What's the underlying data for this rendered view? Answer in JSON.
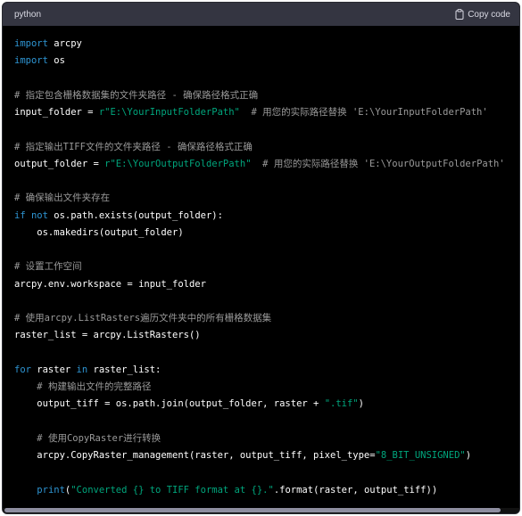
{
  "header": {
    "language": "python",
    "copy_label": "Copy code"
  },
  "code": {
    "lines": [
      [
        {
          "t": "kw",
          "v": "import"
        },
        {
          "t": "pl",
          "v": " arcpy"
        }
      ],
      [
        {
          "t": "kw",
          "v": "import"
        },
        {
          "t": "pl",
          "v": " os"
        }
      ],
      [],
      [
        {
          "t": "cmt",
          "v": "# 指定包含栅格数据集的文件夹路径 - 确保路径格式正确"
        }
      ],
      [
        {
          "t": "pl",
          "v": "input_folder = "
        },
        {
          "t": "str",
          "v": "r\"E:\\YourInputFolderPath\""
        },
        {
          "t": "cmt",
          "v": "  # 用您的实际路径替换 'E:\\YourInputFolderPath'"
        }
      ],
      [],
      [
        {
          "t": "cmt",
          "v": "# 指定输出TIFF文件的文件夹路径 - 确保路径格式正确"
        }
      ],
      [
        {
          "t": "pl",
          "v": "output_folder = "
        },
        {
          "t": "str",
          "v": "r\"E:\\YourOutputFolderPath\""
        },
        {
          "t": "cmt",
          "v": "  # 用您的实际路径替换 'E:\\YourOutputFolderPath'"
        }
      ],
      [],
      [
        {
          "t": "cmt",
          "v": "# 确保输出文件夹存在"
        }
      ],
      [
        {
          "t": "kw",
          "v": "if"
        },
        {
          "t": "pl",
          "v": " "
        },
        {
          "t": "kw",
          "v": "not"
        },
        {
          "t": "pl",
          "v": " os.path.exists(output_folder):"
        }
      ],
      [
        {
          "t": "pl",
          "v": "    os.makedirs(output_folder)"
        }
      ],
      [],
      [
        {
          "t": "cmt",
          "v": "# 设置工作空间"
        }
      ],
      [
        {
          "t": "pl",
          "v": "arcpy.env.workspace = input_folder"
        }
      ],
      [],
      [
        {
          "t": "cmt",
          "v": "# 使用arcpy.ListRasters遍历文件夹中的所有栅格数据集"
        }
      ],
      [
        {
          "t": "pl",
          "v": "raster_list = arcpy.ListRasters()"
        }
      ],
      [],
      [
        {
          "t": "kw",
          "v": "for"
        },
        {
          "t": "pl",
          "v": " raster "
        },
        {
          "t": "kw",
          "v": "in"
        },
        {
          "t": "pl",
          "v": " raster_list:"
        }
      ],
      [
        {
          "t": "pl",
          "v": "    "
        },
        {
          "t": "cmt",
          "v": "# 构建输出文件的完整路径"
        }
      ],
      [
        {
          "t": "pl",
          "v": "    output_tiff = os.path.join(output_folder, raster + "
        },
        {
          "t": "str",
          "v": "\".tif\""
        },
        {
          "t": "pl",
          "v": ")"
        }
      ],
      [],
      [
        {
          "t": "pl",
          "v": "    "
        },
        {
          "t": "cmt",
          "v": "# 使用CopyRaster进行转换"
        }
      ],
      [
        {
          "t": "pl",
          "v": "    arcpy.CopyRaster_management(raster, output_tiff, pixel_type="
        },
        {
          "t": "str",
          "v": "\"8_BIT_UNSIGNED\""
        },
        {
          "t": "pl",
          "v": ")"
        }
      ],
      [],
      [
        {
          "t": "pl",
          "v": "    "
        },
        {
          "t": "kw",
          "v": "print"
        },
        {
          "t": "pl",
          "v": "("
        },
        {
          "t": "str",
          "v": "\"Converted {} to TIFF format at {}.\""
        },
        {
          "t": "pl",
          "v": ".format(raster, output_tiff))"
        }
      ]
    ]
  }
}
